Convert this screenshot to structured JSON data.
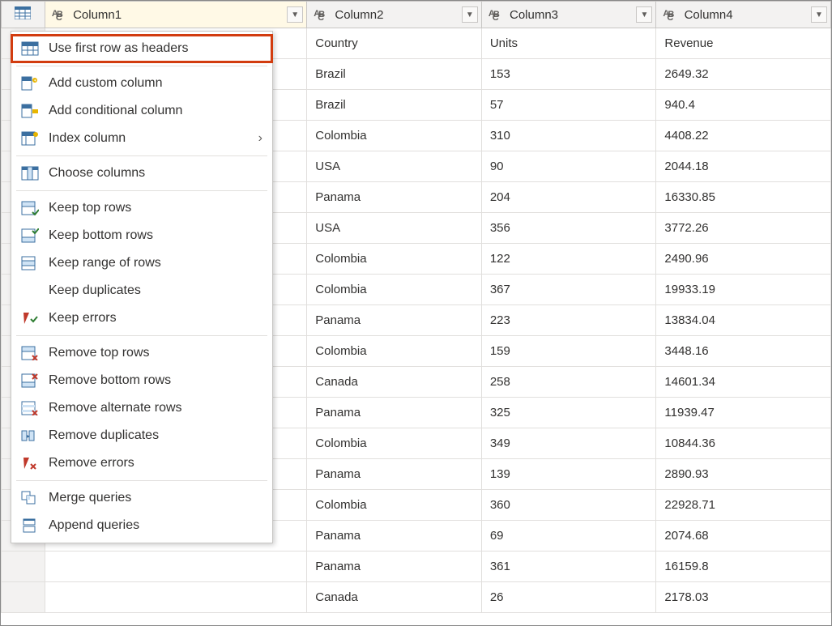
{
  "columns": {
    "c1": "Column1",
    "c2": "Column2",
    "c3": "Column3",
    "c4": "Column4"
  },
  "rows": {
    "r0": {
      "c2": "Country",
      "c3": "Units",
      "c4": "Revenue"
    },
    "r1": {
      "c2": "Brazil",
      "c3": "153",
      "c4": "2649.32"
    },
    "r2": {
      "c2": "Brazil",
      "c3": "57",
      "c4": "940.4"
    },
    "r3": {
      "c2": "Colombia",
      "c3": "310",
      "c4": "4408.22"
    },
    "r4": {
      "c2": "USA",
      "c3": "90",
      "c4": "2044.18"
    },
    "r5": {
      "c2": "Panama",
      "c3": "204",
      "c4": "16330.85"
    },
    "r6": {
      "c2": "USA",
      "c3": "356",
      "c4": "3772.26"
    },
    "r7": {
      "c2": "Colombia",
      "c3": "122",
      "c4": "2490.96"
    },
    "r8": {
      "c2": "Colombia",
      "c3": "367",
      "c4": "19933.19"
    },
    "r9": {
      "c2": "Panama",
      "c3": "223",
      "c4": "13834.04"
    },
    "r10": {
      "c2": "Colombia",
      "c3": "159",
      "c4": "3448.16"
    },
    "r11": {
      "c2": "Canada",
      "c3": "258",
      "c4": "14601.34"
    },
    "r12": {
      "c2": "Panama",
      "c3": "325",
      "c4": "11939.47"
    },
    "r13": {
      "c2": "Colombia",
      "c3": "349",
      "c4": "10844.36"
    },
    "r14": {
      "c2": "Panama",
      "c3": "139",
      "c4": "2890.93"
    },
    "r15": {
      "c2": "Colombia",
      "c3": "360",
      "c4": "22928.71"
    },
    "r16": {
      "c2": "Panama",
      "c3": "69",
      "c4": "2074.68"
    },
    "r17": {
      "c2": "Panama",
      "c3": "361",
      "c4": "16159.8"
    },
    "r18": {
      "c2": "Canada",
      "c3": "26",
      "c4": "2178.03"
    }
  },
  "menu": {
    "use_first_row": "Use first row as headers",
    "add_custom": "Add custom column",
    "add_conditional": "Add conditional column",
    "index_column": "Index column",
    "choose_columns": "Choose columns",
    "keep_top": "Keep top rows",
    "keep_bottom": "Keep bottom rows",
    "keep_range": "Keep range of rows",
    "keep_duplicates": "Keep duplicates",
    "keep_errors": "Keep errors",
    "remove_top": "Remove top rows",
    "remove_bottom": "Remove bottom rows",
    "remove_alternate": "Remove alternate rows",
    "remove_duplicates": "Remove duplicates",
    "remove_errors": "Remove errors",
    "merge_queries": "Merge queries",
    "append_queries": "Append queries"
  }
}
